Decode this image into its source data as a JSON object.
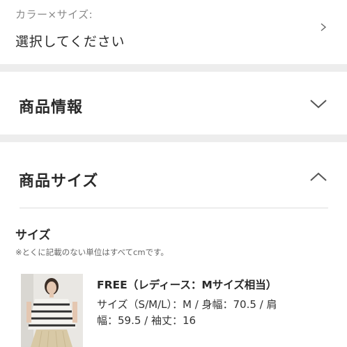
{
  "color_size": {
    "label": "カラー×サイズ:",
    "value": "選択してください"
  },
  "product_info": {
    "title": "商品情報",
    "expanded": false
  },
  "product_size": {
    "title": "商品サイズ",
    "expanded": true,
    "heading": "サイズ",
    "note": "※とくに記載のない単位はすべてcmです。",
    "variant": {
      "title": "FREE（レディース：Mサイズ相当）",
      "detail_line1": "サイズ（S/M/L）：M / 身幅：70.5 / 肩",
      "detail_line2": "幅：59.5 / 袖丈：16"
    }
  },
  "icons": {
    "color_size_chevron": "chevron-right-icon",
    "product_info_chevron": "chevron-down-icon",
    "product_size_chevron": "chevron-up-icon"
  },
  "colors": {
    "section_gap": "#ededed",
    "label_gray": "#8a8a8a",
    "title_text": "#2a2a2a"
  }
}
